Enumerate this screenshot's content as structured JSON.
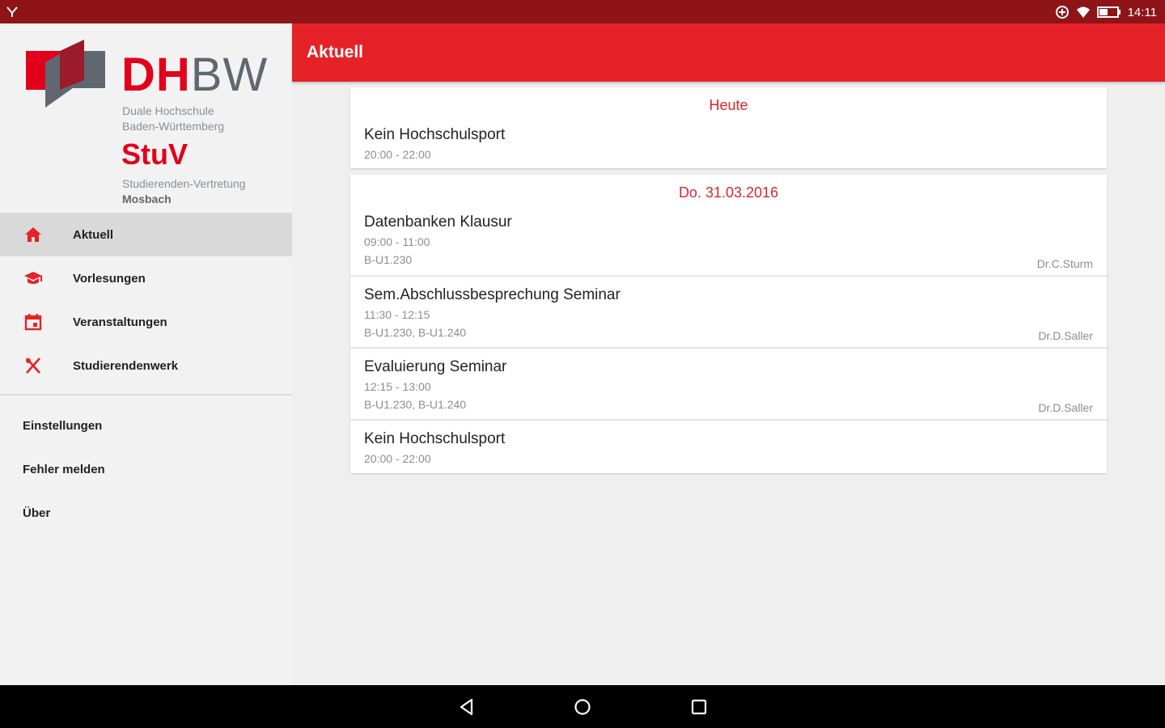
{
  "status_bar": {
    "time": "14:11",
    "icons": [
      "download-notification-icon",
      "data-saver-icon",
      "wifi-icon",
      "battery-icon"
    ]
  },
  "drawer": {
    "logo": {
      "dh": "DH",
      "bw": "BW",
      "line1": "Duale Hochschule",
      "line2": "Baden-Württemberg",
      "stuv": "StuV",
      "line3": "Studierenden-Vertretung",
      "line4": "Mosbach"
    },
    "items": [
      {
        "label": "Aktuell",
        "icon": "home-icon",
        "active": true
      },
      {
        "label": "Vorlesungen",
        "icon": "graduation-cap-icon",
        "active": false
      },
      {
        "label": "Veranstaltungen",
        "icon": "calendar-icon",
        "active": false
      },
      {
        "label": "Studierendenwerk",
        "icon": "cutlery-icon",
        "active": false
      }
    ],
    "secondary": [
      {
        "label": "Einstellungen"
      },
      {
        "label": "Fehler melden"
      },
      {
        "label": "Über"
      }
    ]
  },
  "appbar": {
    "title": "Aktuell"
  },
  "accent_color": "#e52228",
  "days": [
    {
      "heading": "Heute",
      "events": [
        {
          "name": "Kein Hochschulsport",
          "time": "20:00 - 22:00",
          "room": "",
          "lecturer": ""
        }
      ]
    },
    {
      "heading": "Do. 31.03.2016",
      "events": [
        {
          "name": "Datenbanken Klausur",
          "time": "09:00 - 11:00",
          "room": "B-U1.230",
          "lecturer": "Dr.C.Sturm"
        },
        {
          "name": "Sem.Abschlussbesprechung Seminar",
          "time": "11:30 - 12:15",
          "room": "B-U1.230, B-U1.240",
          "lecturer": "Dr.D.Saller"
        },
        {
          "name": "Evaluierung Seminar",
          "time": "12:15 - 13:00",
          "room": "B-U1.230, B-U1.240",
          "lecturer": "Dr.D.Saller"
        },
        {
          "name": "Kein Hochschulsport",
          "time": "20:00 - 22:00",
          "room": "",
          "lecturer": ""
        }
      ]
    }
  ],
  "system_nav": {
    "buttons": [
      "back-icon",
      "home-circle-icon",
      "recents-icon"
    ]
  }
}
